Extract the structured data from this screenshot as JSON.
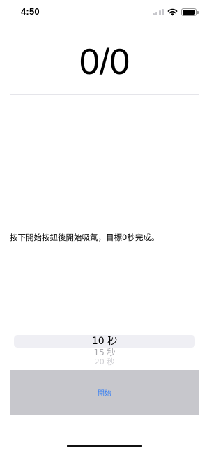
{
  "status_bar": {
    "time": "4:50",
    "icons": [
      "signal-icon",
      "wifi-icon",
      "battery-icon"
    ]
  },
  "counter": {
    "text": "0/0"
  },
  "instruction": {
    "text": "按下開始按鈕後開始吸氣，目標0秒完成。"
  },
  "picker": {
    "selected": "10 秒",
    "options_below": [
      "15 秒",
      "20 秒"
    ]
  },
  "start_button": {
    "label": "開始"
  },
  "colors": {
    "accent": "#2f7bf5",
    "panel": "#c7c7cc",
    "divider": "#e5e5ea",
    "picker_highlight": "#efeff4"
  }
}
